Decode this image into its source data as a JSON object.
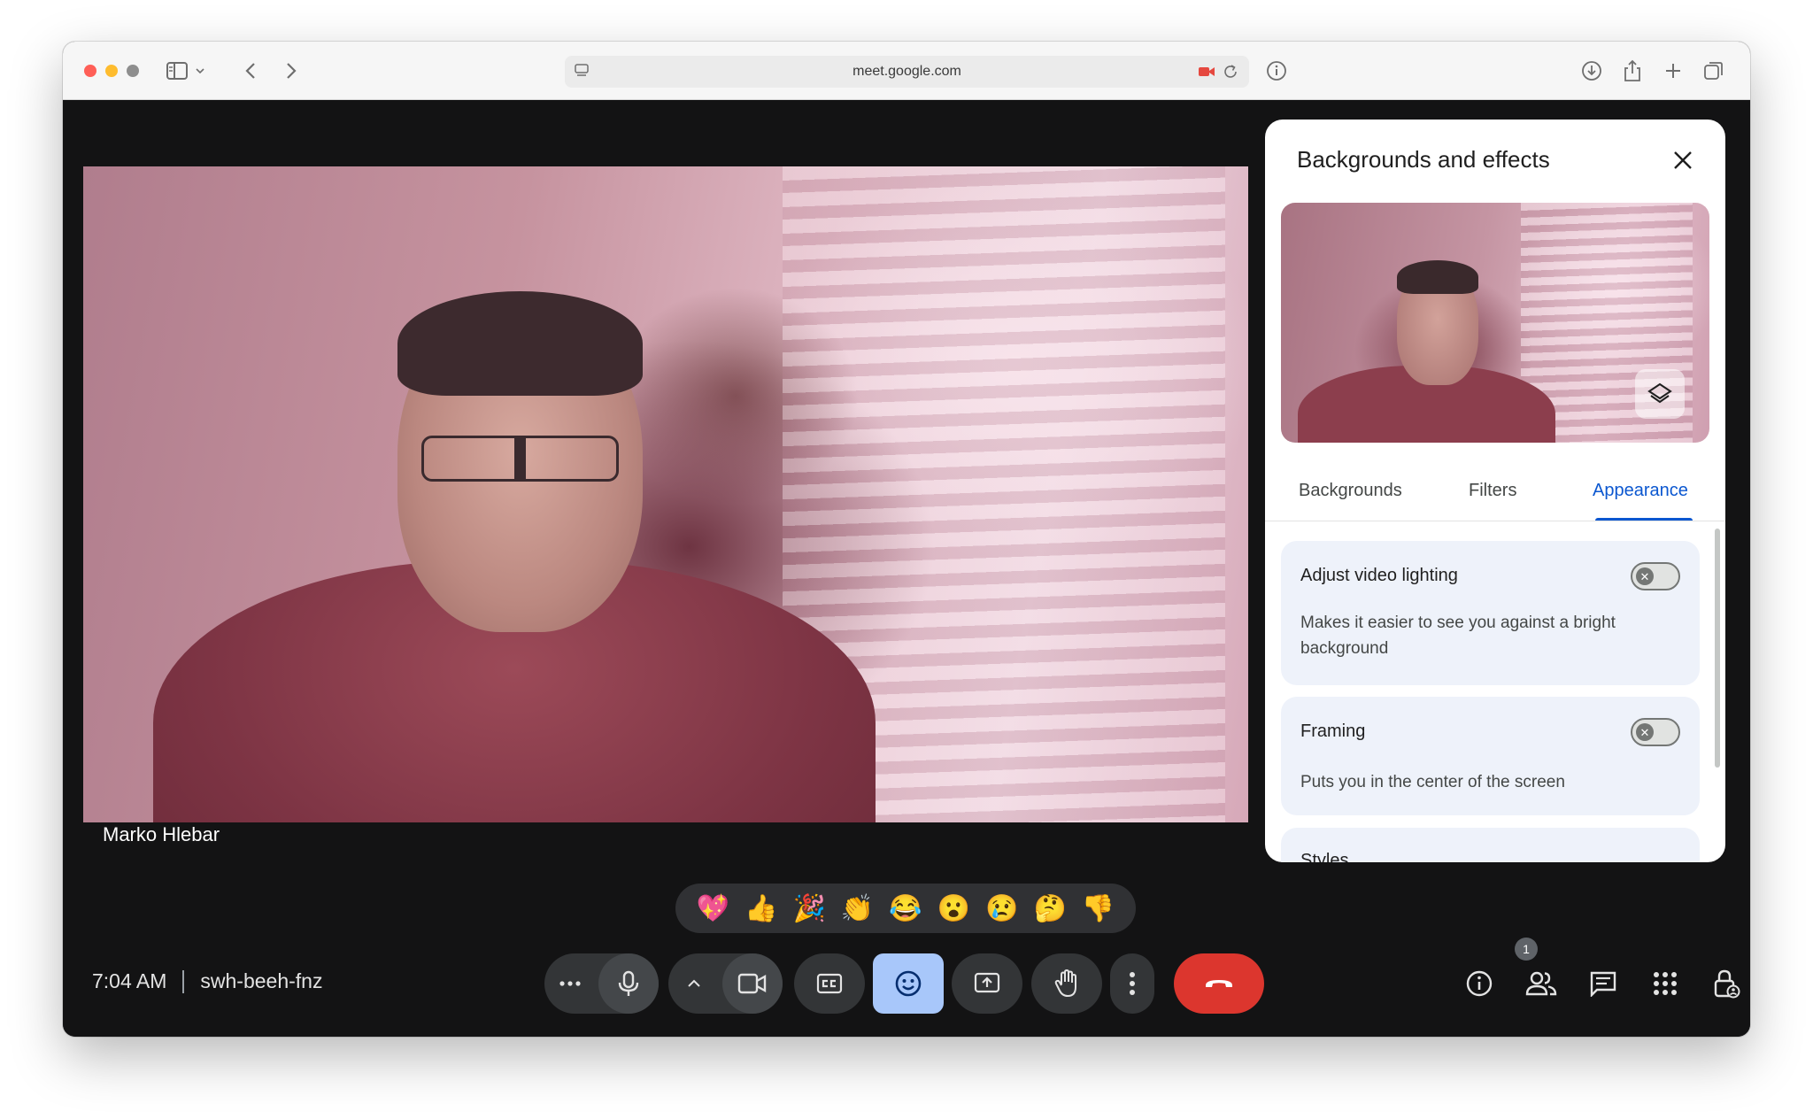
{
  "browser": {
    "url": "meet.google.com",
    "icons": [
      "sidebar-icon",
      "chevron-down-icon",
      "back-icon",
      "forward-icon",
      "site-settings-icon",
      "camera-in-use-icon",
      "reload-icon",
      "info-icon",
      "download-icon",
      "share-icon",
      "new-tab-icon",
      "tab-overview-icon"
    ]
  },
  "video": {
    "participant_name": "Marko Hlebar"
  },
  "panel": {
    "title": "Backgrounds and effects",
    "tabs": [
      {
        "label": "Backgrounds"
      },
      {
        "label": "Filters"
      },
      {
        "label": "Appearance",
        "active": true
      }
    ],
    "cards": [
      {
        "title": "Adjust video lighting",
        "description": "Makes it easier to see you against a bright background",
        "enabled": false
      },
      {
        "title": "Framing",
        "description": "Puts you in the center of the screen",
        "enabled": false
      },
      {
        "title": "Styles"
      }
    ]
  },
  "reactions": [
    "💖",
    "👍",
    "🎉",
    "👏",
    "😂",
    "😮",
    "😢",
    "🤔",
    "👎"
  ],
  "meeting": {
    "time": "7:04 AM",
    "code": "swh-beeh-fnz",
    "people_count": "1"
  },
  "colors": {
    "accent": "#0b57d0",
    "leave": "#dc362e",
    "active_control": "#a8c7fa",
    "background": "#131314"
  }
}
